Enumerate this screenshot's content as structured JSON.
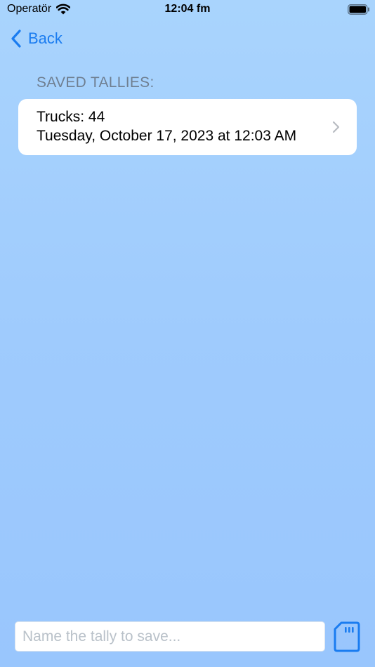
{
  "status_bar": {
    "carrier": "Operatör",
    "time": "12:04 fm"
  },
  "nav": {
    "back_label": "Back"
  },
  "section": {
    "header": "SAVED TALLIES:"
  },
  "tallies": [
    {
      "title": "Trucks: 44",
      "date": "Tuesday, October 17, 2023 at 12:03 AM"
    }
  ],
  "footer": {
    "input_value": "",
    "input_placeholder": "Name the tally to save...",
    "save_icon": "sd-card-icon"
  },
  "colors": {
    "accent": "#1a7cf0",
    "background_top": "#a9d4fd",
    "background_bottom": "#99c6fd",
    "section_header": "#6f7f91"
  }
}
